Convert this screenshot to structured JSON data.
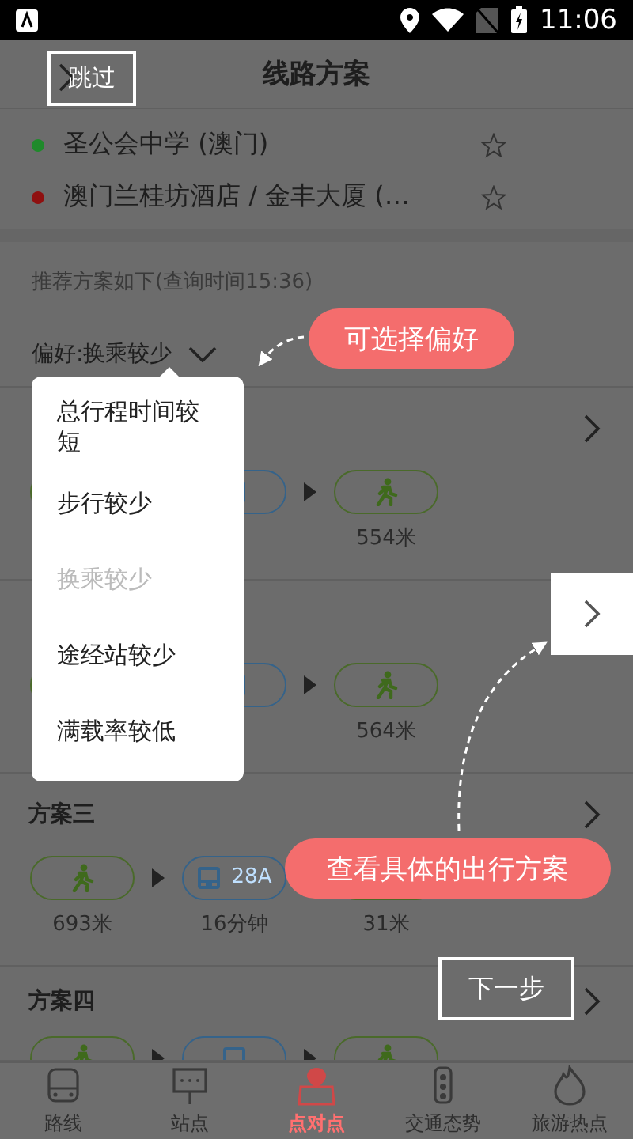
{
  "status_bar": {
    "time": "11:06"
  },
  "header": {
    "title": "线路方案"
  },
  "stops": [
    {
      "name": "圣公会中学 (澳门)",
      "color": "#1f8a2b",
      "favorite": false
    },
    {
      "name": "澳门兰桂坊酒店 / 金丰大厦 (…",
      "color": "#8f1010",
      "favorite": false
    }
  ],
  "query_note": "推荐方案如下(查询时间15:36)",
  "preference": {
    "label": "偏好:换乘较少"
  },
  "plans": [
    {
      "segments": [
        {
          "kind": "walk"
        },
        {
          "kind": "bus"
        },
        {
          "kind": "walk",
          "caption": "554米"
        }
      ]
    },
    {
      "segments": [
        {
          "kind": "walk"
        },
        {
          "kind": "bus"
        },
        {
          "kind": "walk",
          "caption": "564米"
        }
      ]
    },
    {
      "title": "方案三",
      "segments": [
        {
          "kind": "walk",
          "caption": "693米"
        },
        {
          "kind": "bus",
          "route": "28A",
          "caption": "16分钟"
        },
        {
          "kind": "walk",
          "caption": "31米"
        }
      ]
    },
    {
      "title": "方案四",
      "segments": [
        {
          "kind": "walk"
        },
        {
          "kind": "bus"
        },
        {
          "kind": "walk"
        }
      ]
    }
  ],
  "preference_menu": [
    {
      "label": "总行程时间较短",
      "selected": false
    },
    {
      "label": "步行较少",
      "selected": false
    },
    {
      "label": "换乘较少",
      "selected": true
    },
    {
      "label": "途经站较少",
      "selected": false
    },
    {
      "label": "满载率较低",
      "selected": false
    }
  ],
  "guide": {
    "skip_button": "跳过",
    "tip_preference": "可选择偏好",
    "tip_plan": "查看具体的出行方案",
    "next_button": "下一步"
  },
  "nav": [
    {
      "label": "路线",
      "selected": false
    },
    {
      "label": "站点",
      "selected": false
    },
    {
      "label": "点对点",
      "selected": true
    },
    {
      "label": "交通态势",
      "selected": false
    },
    {
      "label": "旅游热点",
      "selected": false
    }
  ]
}
